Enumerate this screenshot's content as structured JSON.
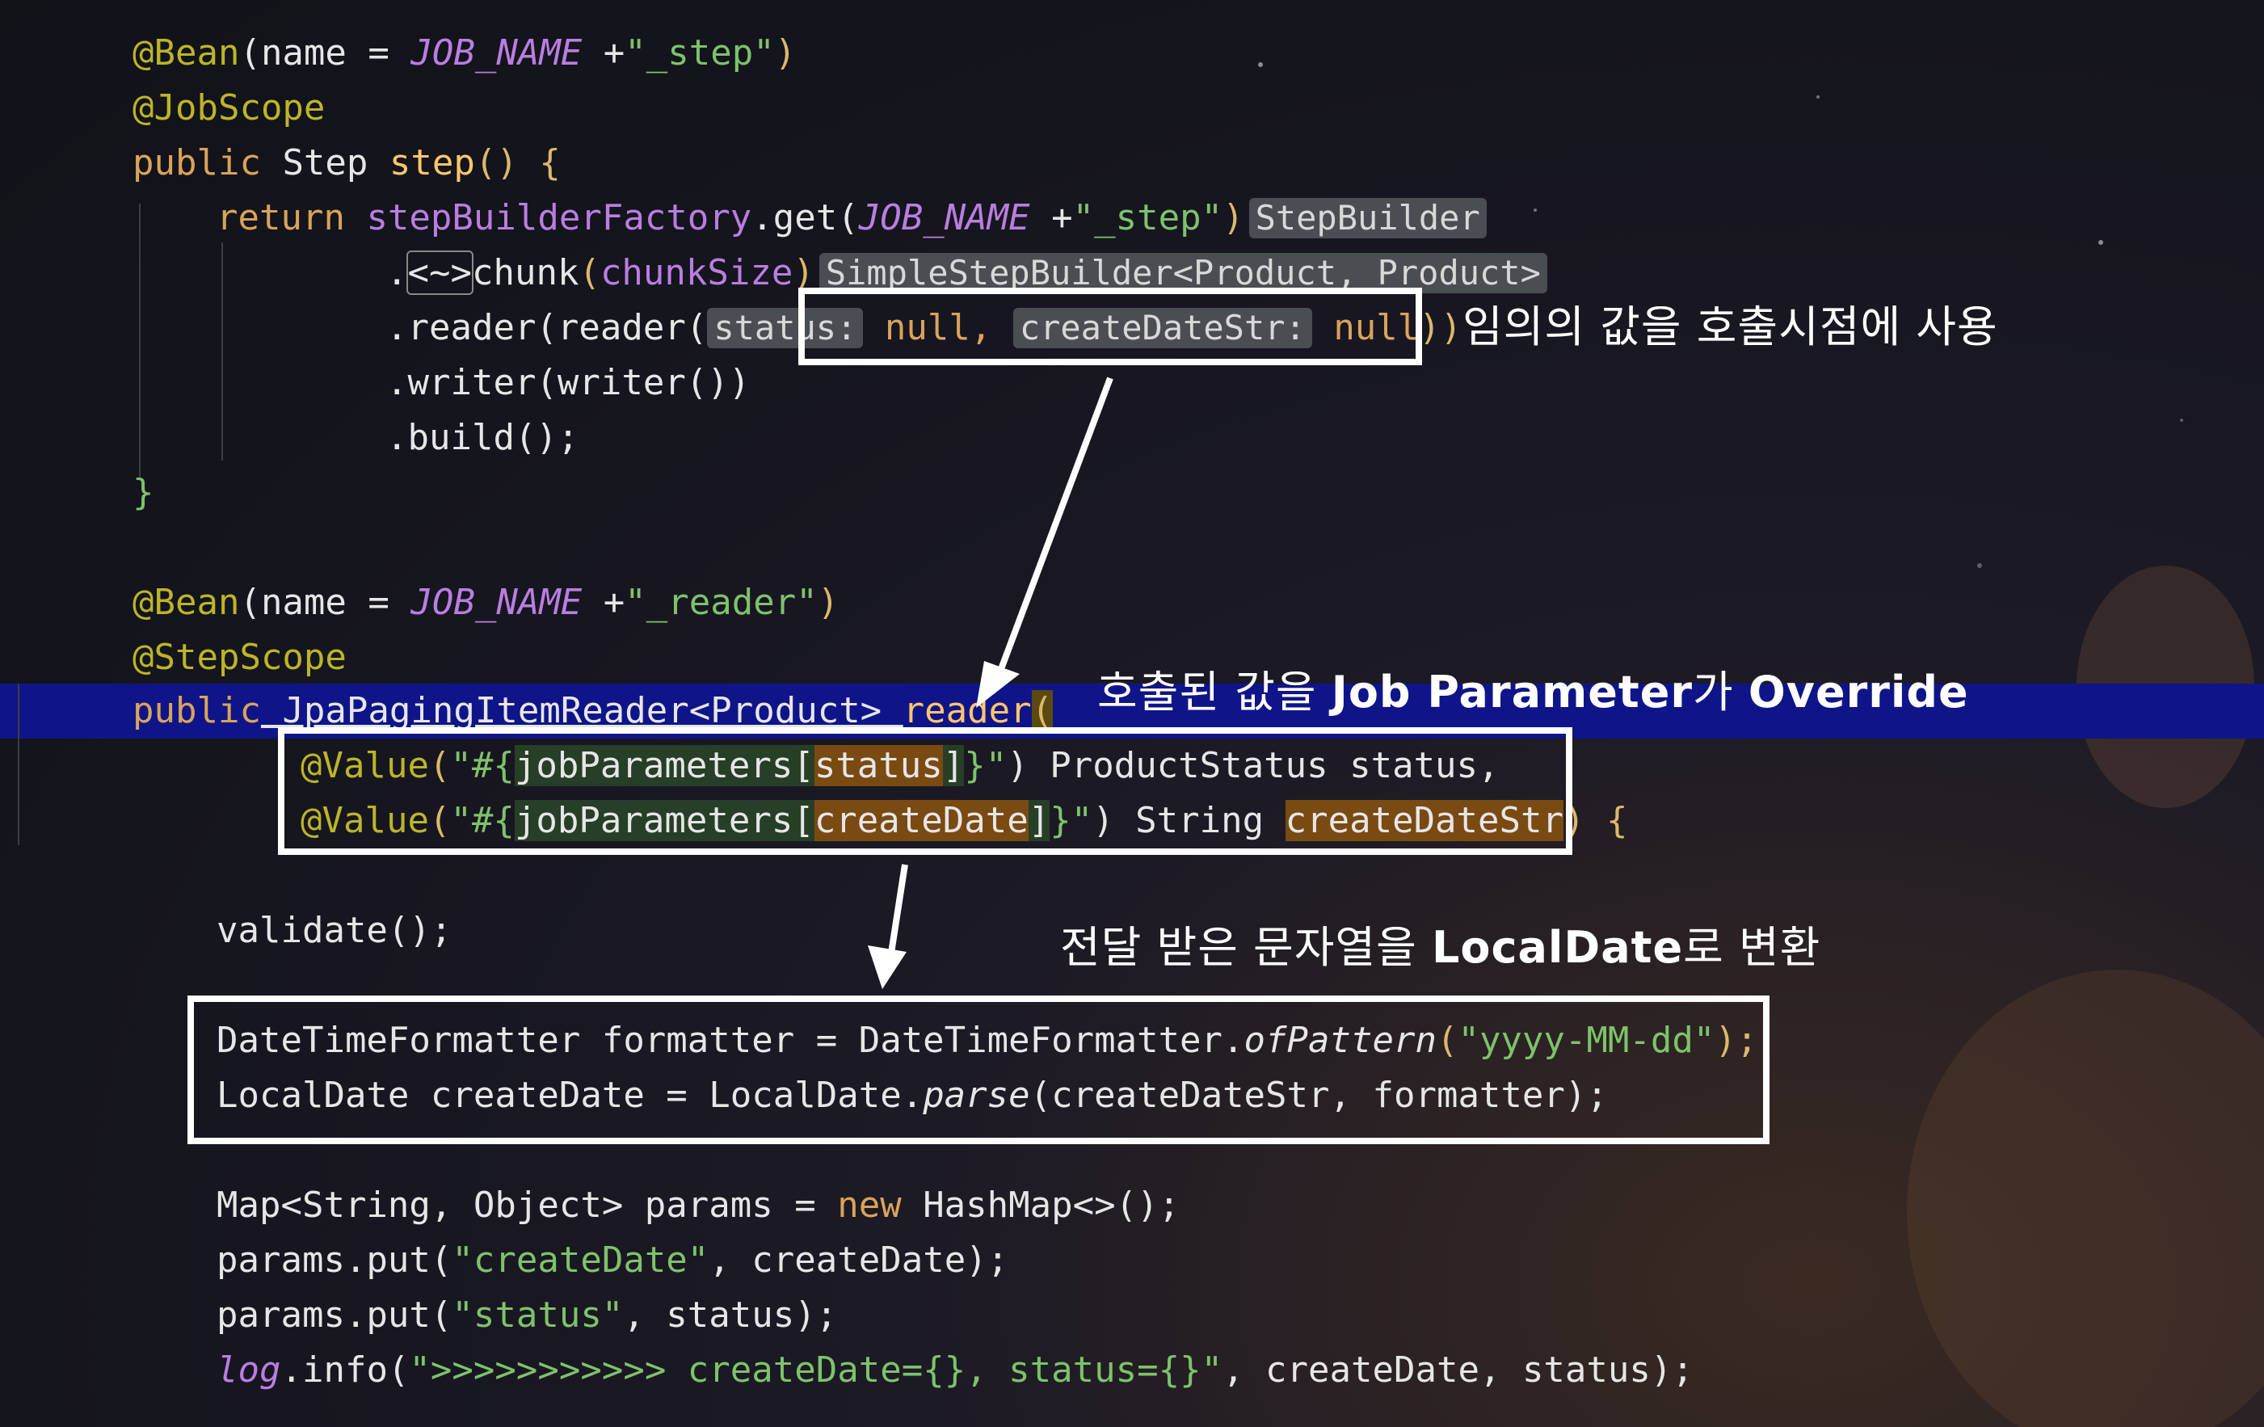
{
  "code": {
    "l1": {
      "ann": "@Bean",
      "p1": "(name = ",
      "cst": "JOB_NAME",
      "p2": " +",
      "str": "\"_step\"",
      "p3": ")"
    },
    "l2": {
      "ann": "@JobScope"
    },
    "l3": {
      "kw": "public",
      "type": " Step ",
      "fn": "step",
      "p": "() {"
    },
    "l4": {
      "kw": "return",
      "fn": " stepBuilderFactory",
      "p1": ".get(",
      "cst": "JOB_NAME",
      "p2": " +",
      "str": "\"_step\"",
      "p3": ")",
      "hint": "StepBuilder"
    },
    "l5": {
      "p1": ".",
      "diamond": "<~>",
      "m": "chunk",
      "p2": "(",
      "arg": "chunkSize",
      "p3": ")",
      "hint": "SimpleStepBuilder<Product, Product>"
    },
    "l6": {
      "p1": ".reader(reader(",
      "hint1": "status:",
      "v1": " null, ",
      "hint2": "createDateStr:",
      "v2": " null",
      "p2": "))"
    },
    "l7": {
      "p": ".writer(writer())"
    },
    "l8": {
      "p": ".build();"
    },
    "l9": {
      "p": "}"
    },
    "l10": {
      "ann": "@Bean",
      "p1": "(name = ",
      "cst": "JOB_NAME",
      "p2": " +",
      "str": "\"_reader\"",
      "p3": ")"
    },
    "l11": {
      "ann": "@StepScope"
    },
    "l12": {
      "kw": "public",
      "type": " JpaPagingItemReader<Product> ",
      "fn": "reader",
      "p": "("
    },
    "l13": {
      "ann": "@Value",
      "p1": "(",
      "s1": "\"#{",
      "s2": "jobParameters[",
      "s3": "status",
      "s4": "]",
      "s5": "}\"",
      "p2": ") ProductStatus status,"
    },
    "l14": {
      "ann": "@Value",
      "p1": "(",
      "s1": "\"#{",
      "s2": "jobParameters[",
      "s3": "createDate",
      "s4": "]",
      "s5": "}\"",
      "p2": ") String ",
      "v": "createDateStr",
      "p3": ") {"
    },
    "l15": {
      "p": "validate();"
    },
    "l16": {
      "p1": "DateTimeFormatter formatter = DateTimeFormatter.",
      "m": "ofPattern",
      "p2": "(",
      "str": "\"yyyy-MM-dd\"",
      "p3": ");"
    },
    "l17": {
      "p1": "LocalDate createDate = LocalDate.",
      "m": "parse",
      "p2": "(createDateStr, formatter);"
    },
    "l18": {
      "p1": "Map<String, Object> params = ",
      "kw": "new",
      "p2": " HashMap<>();"
    },
    "l19": {
      "p1": "params.put(",
      "str": "\"createDate\"",
      "p2": ", createDate);"
    },
    "l20": {
      "p1": "params.put(",
      "str": "\"status\"",
      "p2": ", status);"
    },
    "l21": {
      "lg": "log",
      "p1": ".info(",
      "str": "\">>>>>>>>>>> createDate={}, status={}\"",
      "p2": ", createDate, status);"
    }
  },
  "callouts": {
    "c1": "임의의 값을 호출시점에 사용",
    "c2a": "호출된 값을 ",
    "c2b": "Job Parameter",
    "c2c": "가 ",
    "c2d": "Override",
    "c3a": "전달 받은 문자열을 ",
    "c3b": "LocalDate",
    "c3c": "로 변환"
  },
  "colors": {
    "annotation": "#bbb529",
    "keyword": "#d9a35a",
    "string": "#7ec26b",
    "constant": "#b97ee0",
    "selection": "#0f1589",
    "box": "#ffffff"
  }
}
